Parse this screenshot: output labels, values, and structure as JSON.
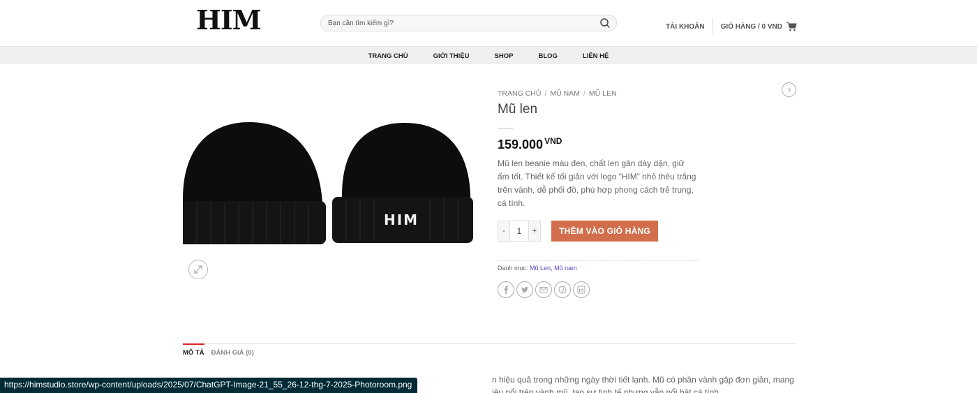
{
  "header": {
    "logo_text": "HIM",
    "search_placeholder": "Bạn cần tìm kiếm gì?",
    "account_label": "TÀI KHOẢN",
    "cart_label": "GIỎ HÀNG / 0 VND"
  },
  "nav": {
    "items": [
      "TRANG CHỦ",
      "GIỚI THIỆU",
      "SHOP",
      "BLOG",
      "LIÊN HỆ"
    ]
  },
  "product": {
    "breadcrumb": [
      "TRANG CHỦ",
      "MŨ NAM",
      "MŨ LEN"
    ],
    "title": "Mũ len",
    "price": "159.000",
    "currency": "VND",
    "description": "Mũ len beanie màu đen, chất len gân dày dặn, giữ ấm tốt. Thiết kế tối giản với logo “HIM” nhỏ thêu trắng trên vành, dễ phối đồ, phù hợp phong cách trẻ trung, cá tính.",
    "quantity": "1",
    "qty_minus": "-",
    "qty_plus": "+",
    "add_to_cart": "THÊM VÀO GIỎ HÀNG",
    "category_label": "Danh mục:",
    "categories": "Mũ Len, Mũ nam",
    "hat_logo": "HIM"
  },
  "tabs": {
    "items": [
      "MÔ TẢ",
      "ĐÁNH GIÁ (0)"
    ],
    "content_line1": "n hiệu quả trong những ngày thời tiết lạnh. Mũ có phần vành gập đơn giản, mang",
    "content_line2": "iêu nổi trên vành mũ, tạo sự tinh tế nhưng vẫn nổi bật cá tính."
  },
  "status_url": "https://himstudio.store/wp-content/uploads/2025/07/ChatGPT-Image-21_55_26-12-thg-7-2025-Photoroom.png",
  "colors": {
    "accent": "#d26e4b",
    "active_tab": "#e02020",
    "link": "#5a3fc0"
  }
}
